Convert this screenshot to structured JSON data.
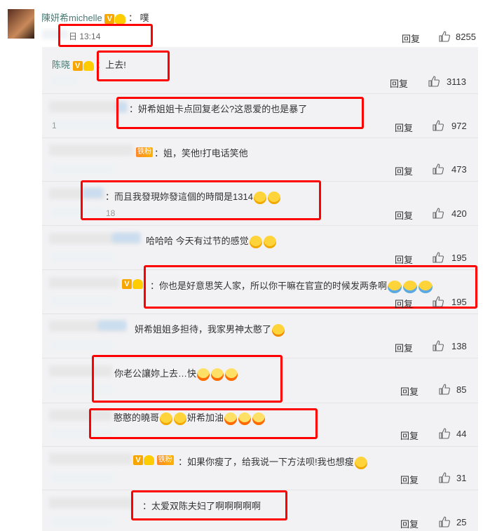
{
  "main_comment": {
    "author": "陳妍希michelle",
    "text": "噗",
    "time": "日 13:14",
    "reply_label": "回复",
    "likes": "8255"
  },
  "replies": [
    {
      "author": "陈晓",
      "text": "上去!",
      "likes": "3113",
      "reply_label": "回复"
    },
    {
      "author": "",
      "text": "妍希姐姐卡点回复老公?这恩爱的也是暴了",
      "likes": "972",
      "reply_label": "回复",
      "time_fragment": "1"
    },
    {
      "author": "",
      "badge": "铁粉",
      "text": "姐，笑他!打电话笑他",
      "likes": "473",
      "reply_label": "回复"
    },
    {
      "author": "",
      "text": "而且我發現妳發這個的時間是1314",
      "likes": "420",
      "reply_label": "回复",
      "time_fragment": "18"
    },
    {
      "author": "",
      "text": "哈哈哈   今天有过节的感觉",
      "likes": "195",
      "reply_label": "回复"
    },
    {
      "author": "",
      "text": "你也是好意思笑人家，所以你干嘛在官宣的时候发两条啊",
      "likes": "195",
      "reply_label": "回复"
    },
    {
      "author": "",
      "text": "妍希姐姐多担待，我家男神太憨了",
      "likes": "138",
      "reply_label": "回复"
    },
    {
      "author": "",
      "text": "你老公讓妳上去…快",
      "likes": "85",
      "reply_label": "回复"
    },
    {
      "author": "",
      "text": "憨憨的曉哥",
      "text2": "妍希加油",
      "likes": "44",
      "reply_label": "回复"
    },
    {
      "author": "",
      "badge": "铁粉",
      "text": "如果你瘦了，给我说一下方法呗!我也想瘦",
      "likes": "31",
      "reply_label": "回复"
    },
    {
      "author": "",
      "text": "太爱双陈夫妇了啊啊啊啊啊",
      "likes": "25",
      "reply_label": "回复"
    }
  ],
  "icons": {
    "like": "thumbs-up-icon",
    "verified": "v-badge-icon",
    "crown": "crown-icon"
  },
  "colors": {
    "highlight_box": "#ff0000",
    "author_name": "#4a7a73",
    "sub_bg": "#f2f2f5"
  }
}
